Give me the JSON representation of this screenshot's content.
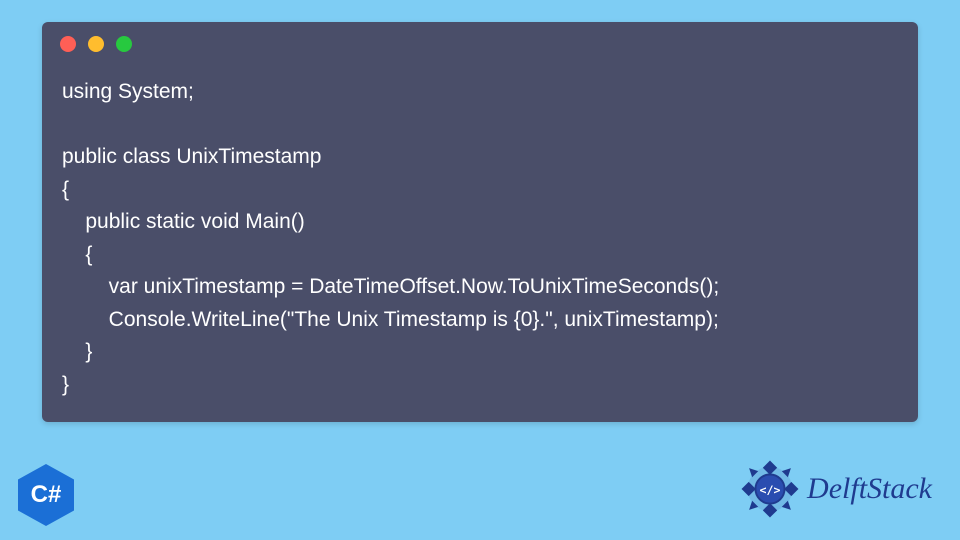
{
  "code_lines": [
    "using System;",
    "",
    "public class UnixTimestamp",
    "{",
    "    public static void Main()",
    "    {",
    "        var unixTimestamp = DateTimeOffset.Now.ToUnixTimeSeconds();",
    "        Console.WriteLine(\"The Unix Timestamp is {0}.\", unixTimestamp);",
    "    }",
    "}"
  ],
  "badge_label": "C#",
  "brand_name": "DelftStack",
  "colors": {
    "background": "#7ecdf4",
    "code_bg": "#4a4e69",
    "code_text": "#ffffff",
    "dot_red": "#ff5f56",
    "dot_yellow": "#ffbd2e",
    "dot_green": "#27c93f",
    "csharp_hex": "#1b6fd6",
    "brand_text": "#1f3b8f"
  }
}
